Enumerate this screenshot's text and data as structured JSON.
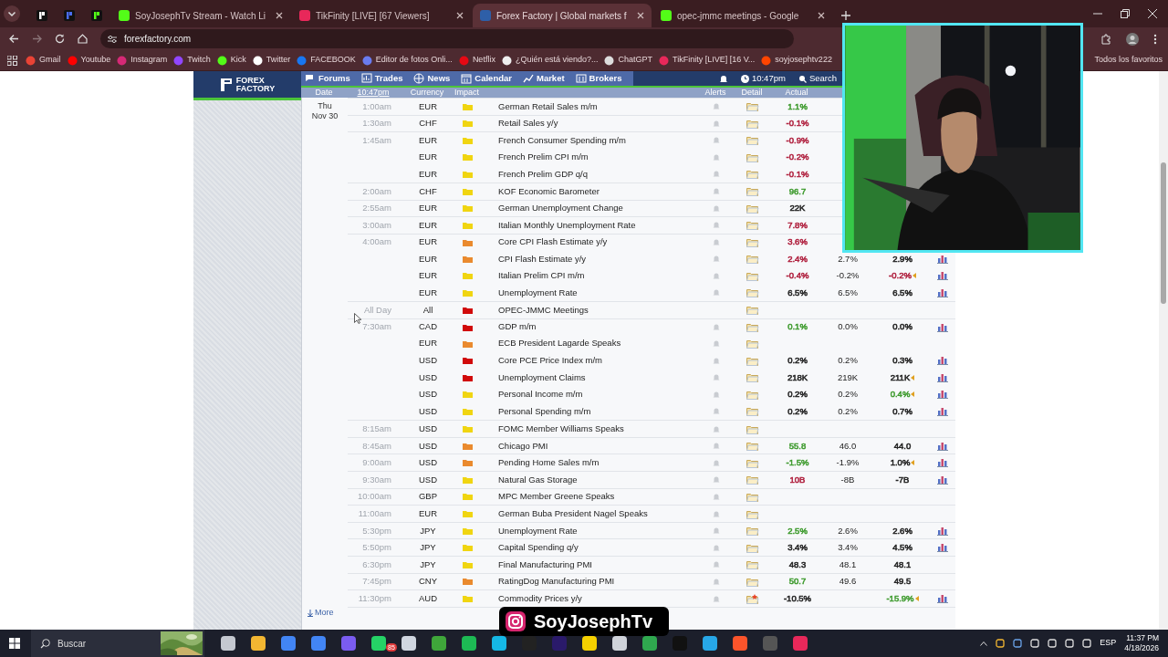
{
  "browser": {
    "tabs": [
      {
        "kind": "pinned",
        "selected": false
      },
      {
        "kind": "pinned",
        "selected": false
      },
      {
        "kind": "pinned",
        "selected": false
      },
      {
        "kind": "tab",
        "label": "SoyJosephTv Stream - Watch Li",
        "selected": false
      },
      {
        "kind": "tab",
        "label": "TikFinity [LIVE] [67 Viewers]",
        "selected": false
      },
      {
        "kind": "tab",
        "label": "Forex Factory | Global markets f",
        "selected": true
      },
      {
        "kind": "tab",
        "label": "opec-jmmc meetings - Google",
        "selected": false
      }
    ],
    "address": "forexfactory.com",
    "bookmarks": [
      "Gmail",
      "Youtube",
      "Instagram",
      "Twitch",
      "Kick",
      "Twitter",
      "FACEBOOK",
      "Editor de fotos Onli...",
      "Netflix",
      "¿Quién está viendo?...",
      "ChatGPT",
      "TikFinity [LIVE] [16 V...",
      "soyjosephtv222"
    ],
    "all_bookmarks": "Todos los favoritos"
  },
  "site": {
    "logo": [
      "FOREX",
      "FACTORY"
    ],
    "nav": [
      "Forums",
      "Trades",
      "News",
      "Calendar",
      "Market",
      "Brokers"
    ],
    "clock": "10:47pm",
    "search": "Search",
    "columns": {
      "date": "Date",
      "time": "10:47pm",
      "currency": "Currency",
      "impact": "Impact",
      "alerts": "Alerts",
      "detail": "Detail",
      "actual": "Actual"
    },
    "day": "Thu",
    "date": "Nov 30",
    "rows": [
      {
        "time": "1:00am",
        "currency": "EUR",
        "impact": {
          "color": "#f0d511"
        },
        "event": "German Retail Sales m/m",
        "alert": true,
        "detail_new": false,
        "actual": {
          "value": "1.1%",
          "color": "#3f9b2f"
        }
      },
      {
        "time": "1:30am",
        "currency": "CHF",
        "impact": {
          "color": "#f0d511"
        },
        "event": "Retail Sales y/y",
        "alert": true,
        "detail_new": false,
        "actual": {
          "value": "-0.1%",
          "color": "#b0213f"
        }
      },
      {
        "time": "1:45am",
        "currency": "EUR",
        "impact": {
          "color": "#f0d511"
        },
        "event": "French Consumer Spending m/m",
        "alert": true,
        "detail_new": false,
        "actual": {
          "value": "-0.9%",
          "color": "#b0213f"
        }
      },
      {
        "currency": "EUR",
        "impact": {
          "color": "#f0d511"
        },
        "event": "French Prelim CPI m/m",
        "alert": true,
        "detail_new": false,
        "actual": {
          "value": "-0.2%",
          "color": "#b0213f"
        }
      },
      {
        "currency": "EUR",
        "impact": {
          "color": "#f0d511"
        },
        "event": "French Prelim GDP q/q",
        "alert": true,
        "detail_new": false,
        "actual": {
          "value": "-0.1%",
          "color": "#b0213f"
        }
      },
      {
        "time": "2:00am",
        "currency": "CHF",
        "impact": {
          "color": "#f0d511"
        },
        "event": "KOF Economic Barometer",
        "alert": true,
        "detail_new": false,
        "actual": {
          "value": "96.7",
          "color": "#3f9b2f"
        }
      },
      {
        "time": "2:55am",
        "currency": "EUR",
        "impact": {
          "color": "#f0d511"
        },
        "event": "German Unemployment Change",
        "alert": true,
        "detail_new": false,
        "actual": {
          "value": "22K",
          "color": "#222222"
        }
      },
      {
        "time": "3:00am",
        "currency": "EUR",
        "impact": {
          "color": "#f0d511"
        },
        "event": "Italian Monthly Unemployment Rate",
        "alert": true,
        "detail_new": false,
        "actual": {
          "value": "7.8%",
          "color": "#b0213f"
        }
      },
      {
        "time": "4:00am",
        "currency": "EUR",
        "impact": {
          "color": "#ea8a2e"
        },
        "event": "Core CPI Flash Estimate y/y",
        "alert": true,
        "detail_new": false,
        "actual": {
          "value": "3.6%",
          "color": "#b0213f"
        }
      },
      {
        "currency": "EUR",
        "impact": {
          "color": "#ea8a2e"
        },
        "event": "CPI Flash Estimate y/y",
        "alert": true,
        "detail_new": false,
        "actual": {
          "value": "2.4%",
          "color": "#b0213f"
        },
        "forecast": "2.7%",
        "previous": {
          "value": "2.9%",
          "color": "#222222"
        },
        "revised": false,
        "graph": true
      },
      {
        "currency": "EUR",
        "impact": {
          "color": "#f0d511"
        },
        "event": "Italian Prelim CPI m/m",
        "alert": true,
        "detail_new": false,
        "actual": {
          "value": "-0.4%",
          "color": "#b0213f"
        },
        "forecast": "-0.2%",
        "previous": {
          "value": "-0.2%",
          "color": "#b0213f"
        },
        "revised": true,
        "graph": true
      },
      {
        "currency": "EUR",
        "impact": {
          "color": "#f0d511"
        },
        "event": "Unemployment Rate",
        "alert": true,
        "detail_new": false,
        "actual": {
          "value": "6.5%",
          "color": "#222222"
        },
        "forecast": "6.5%",
        "previous": {
          "value": "6.5%",
          "color": "#222222"
        },
        "revised": false,
        "graph": true
      },
      {
        "time": "All Day",
        "currency": "All",
        "impact": {
          "color": "#d10a0a"
        },
        "event": "OPEC-JMMC Meetings",
        "alert": false,
        "detail_new": false,
        "revised": false,
        "graph": false
      },
      {
        "time": "7:30am",
        "currency": "CAD",
        "impact": {
          "color": "#d10a0a"
        },
        "event": "GDP m/m",
        "alert": true,
        "detail_new": false,
        "actual": {
          "value": "0.1%",
          "color": "#3f9b2f"
        },
        "forecast": "0.0%",
        "previous": {
          "value": "0.0%",
          "color": "#222222"
        },
        "revised": false,
        "graph": true
      },
      {
        "currency": "EUR",
        "impact": {
          "color": "#ea8a2e"
        },
        "event": "ECB President Lagarde Speaks",
        "alert": true,
        "detail_new": false,
        "revised": false,
        "graph": false
      },
      {
        "currency": "USD",
        "impact": {
          "color": "#d10a0a"
        },
        "event": "Core PCE Price Index m/m",
        "alert": true,
        "detail_new": false,
        "actual": {
          "value": "0.2%",
          "color": "#222222"
        },
        "forecast": "0.2%",
        "previous": {
          "value": "0.3%",
          "color": "#222222"
        },
        "revised": false,
        "graph": true
      },
      {
        "currency": "USD",
        "impact": {
          "color": "#d10a0a"
        },
        "event": "Unemployment Claims",
        "alert": true,
        "detail_new": false,
        "actual": {
          "value": "218K",
          "color": "#222222"
        },
        "forecast": "219K",
        "previous": {
          "value": "211K",
          "color": "#222222"
        },
        "revised": true,
        "graph": true
      },
      {
        "currency": "USD",
        "impact": {
          "color": "#f0d511"
        },
        "event": "Personal Income m/m",
        "alert": true,
        "detail_new": false,
        "actual": {
          "value": "0.2%",
          "color": "#222222"
        },
        "forecast": "0.2%",
        "previous": {
          "value": "0.4%",
          "color": "#3f9b2f"
        },
        "revised": true,
        "graph": true
      },
      {
        "currency": "USD",
        "impact": {
          "color": "#f0d511"
        },
        "event": "Personal Spending m/m",
        "alert": true,
        "detail_new": false,
        "actual": {
          "value": "0.2%",
          "color": "#222222"
        },
        "forecast": "0.2%",
        "previous": {
          "value": "0.7%",
          "color": "#222222"
        },
        "revised": false,
        "graph": true
      },
      {
        "time": "8:15am",
        "currency": "USD",
        "impact": {
          "color": "#f0d511"
        },
        "event": "FOMC Member Williams Speaks",
        "alert": true,
        "detail_new": false,
        "revised": false,
        "graph": false
      },
      {
        "time": "8:45am",
        "currency": "USD",
        "impact": {
          "color": "#ea8a2e"
        },
        "event": "Chicago PMI",
        "alert": true,
        "detail_new": false,
        "actual": {
          "value": "55.8",
          "color": "#3f9b2f"
        },
        "forecast": "46.0",
        "previous": {
          "value": "44.0",
          "color": "#222222"
        },
        "revised": false,
        "graph": true
      },
      {
        "time": "9:00am",
        "currency": "USD",
        "impact": {
          "color": "#ea8a2e"
        },
        "event": "Pending Home Sales m/m",
        "alert": true,
        "detail_new": false,
        "actual": {
          "value": "-1.5%",
          "color": "#3f9b2f"
        },
        "forecast": "-1.9%",
        "previous": {
          "value": "1.0%",
          "color": "#222222"
        },
        "revised": true,
        "graph": true
      },
      {
        "time": "9:30am",
        "currency": "USD",
        "impact": {
          "color": "#f0d511"
        },
        "event": "Natural Gas Storage",
        "alert": true,
        "detail_new": false,
        "actual": {
          "value": "10B",
          "color": "#b0213f"
        },
        "forecast": "-8B",
        "previous": {
          "value": "-7B",
          "color": "#222222"
        },
        "revised": false,
        "graph": true
      },
      {
        "time": "10:00am",
        "currency": "GBP",
        "impact": {
          "color": "#f0d511"
        },
        "event": "MPC Member Greene Speaks",
        "alert": true,
        "detail_new": false,
        "revised": false,
        "graph": false
      },
      {
        "time": "11:00am",
        "currency": "EUR",
        "impact": {
          "color": "#f0d511"
        },
        "event": "German Buba President Nagel Speaks",
        "alert": true,
        "detail_new": false,
        "revised": false,
        "graph": false
      },
      {
        "time": "5:30pm",
        "currency": "JPY",
        "impact": {
          "color": "#f0d511"
        },
        "event": "Unemployment Rate",
        "alert": true,
        "detail_new": false,
        "actual": {
          "value": "2.5%",
          "color": "#3f9b2f"
        },
        "forecast": "2.6%",
        "previous": {
          "value": "2.6%",
          "color": "#222222"
        },
        "revised": false,
        "graph": true
      },
      {
        "time": "5:50pm",
        "currency": "JPY",
        "impact": {
          "color": "#f0d511"
        },
        "event": "Capital Spending q/y",
        "alert": true,
        "detail_new": false,
        "actual": {
          "value": "3.4%",
          "color": "#222222"
        },
        "forecast": "3.4%",
        "previous": {
          "value": "4.5%",
          "color": "#222222"
        },
        "revised": false,
        "graph": true
      },
      {
        "time": "6:30pm",
        "currency": "JPY",
        "impact": {
          "color": "#f0d511"
        },
        "event": "Final Manufacturing PMI",
        "alert": true,
        "detail_new": false,
        "actual": {
          "value": "48.3",
          "color": "#222222"
        },
        "forecast": "48.1",
        "previous": {
          "value": "48.1",
          "color": "#222222"
        },
        "revised": false,
        "graph": false
      },
      {
        "time": "7:45pm",
        "currency": "CNY",
        "impact": {
          "color": "#ea8a2e"
        },
        "event": "RatingDog Manufacturing PMI",
        "alert": true,
        "detail_new": false,
        "actual": {
          "value": "50.7",
          "color": "#3f9b2f"
        },
        "forecast": "49.6",
        "previous": {
          "value": "49.5",
          "color": "#222222"
        },
        "revised": false,
        "graph": false
      },
      {
        "time": "11:30pm",
        "currency": "AUD",
        "impact": {
          "color": "#f0d511"
        },
        "event": "Commodity Prices y/y",
        "alert": true,
        "detail_new": true,
        "actual": {
          "value": "-10.5%",
          "color": "#222222"
        },
        "previous": {
          "value": "-15.9%",
          "color": "#3f9b2f"
        },
        "revised": true,
        "graph": true
      }
    ],
    "more": "More"
  },
  "overlay": {
    "handle": "SoyJosephTv"
  },
  "taskbar": {
    "search": "Buscar",
    "badge": "85",
    "language": "ESP",
    "time": "11:37 PM",
    "date": "4/18/2026"
  }
}
